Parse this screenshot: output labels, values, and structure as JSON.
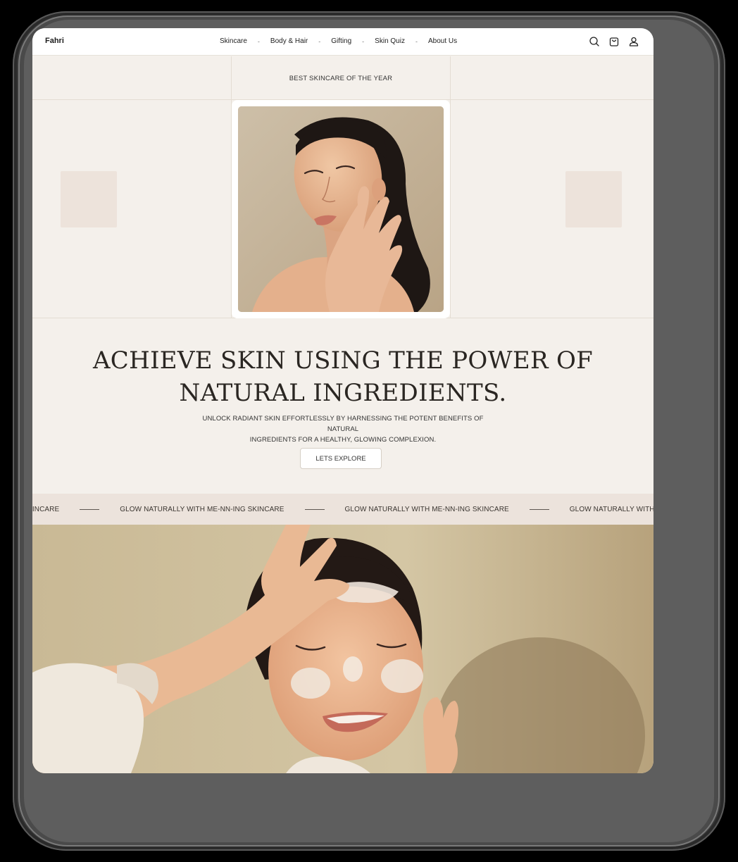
{
  "brand": {
    "logo": "Fahri"
  },
  "nav": {
    "links": [
      "Skincare",
      "Body & Hair",
      "Gifting",
      "Skin Quiz",
      "About Us"
    ],
    "separator": "-",
    "icons": [
      "search-icon",
      "cart-icon",
      "user-icon"
    ]
  },
  "hero": {
    "tag": "BEST SKINCARE OF THE YEAR",
    "headline_line1": "ACHIEVE SKIN USING THE POWER OF",
    "headline_line2": "NATURAL INGREDIENTS.",
    "sub_line1": "UNLOCK RADIANT SKIN EFFORTLESSLY BY HARNESSING THE POTENT BENEFITS OF NATURAL",
    "sub_line2": "INGREDIENTS FOR A HEALTHY, GLOWING COMPLEXION.",
    "cta": "LETS EXPLORE"
  },
  "marquee": {
    "items": [
      "GLOW NATURALLY WITH ME-NN-ING SKINCARE",
      "GLOW NATURALLY WITH ME-NN-ING SKINCARE",
      "GLOW NATURALLY WITH ME-NN-ING SKINCARE",
      "GLOW NATURALLY WITH ME-NN-ING SKINCARE"
    ]
  },
  "colors": {
    "page_bg": "#f4f0eb",
    "accent_square": "#ede3db",
    "marquee_bg": "#ece3dc",
    "text_dark": "#2a2622"
  }
}
